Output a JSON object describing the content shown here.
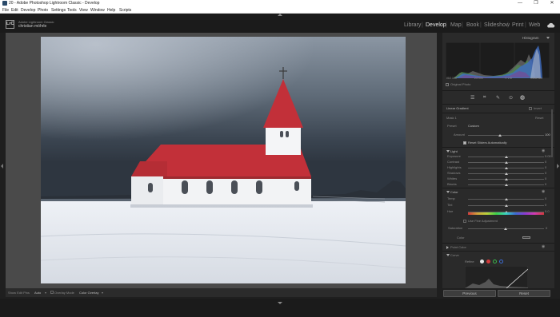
{
  "window": {
    "title": "20 - Adobe Photoshop Lightroom Classic - Develop",
    "controls": [
      "—",
      "❐",
      "✕"
    ]
  },
  "menu": [
    "File",
    "Edit",
    "Develop",
    "Photo",
    "Settings",
    "Tools",
    "View",
    "Window",
    "Help",
    "Scripts"
  ],
  "identity": {
    "logo": "LrC",
    "product": "Adobe Lightroom Classic",
    "user": "christian möhrle"
  },
  "modules": [
    "Library",
    "Develop",
    "Map",
    "Book",
    "Slideshow",
    "Print",
    "Web"
  ],
  "modules_separator": "|",
  "active_module": "Develop",
  "histogram": {
    "title": "Histogram",
    "iso": "ISO 100",
    "focal": "23 mm",
    "aperture": "f / 2.8",
    "shutter": "1/640 sec",
    "original_photo_label": "Original Photo"
  },
  "masking": {
    "mask_name": "Linear Gradient",
    "invert_label": "Invert",
    "mask_label": "Mask 1",
    "reset_label": "Reset",
    "preset_label": "Preset",
    "preset_value": "Custom",
    "amount_label": "Amount",
    "amount_value": "100",
    "reset_sliders_label": "Reset Sliders Automatically"
  },
  "light": {
    "title": "Light",
    "sliders": [
      {
        "label": "Exposure",
        "value": "0.00",
        "pos": 0.5
      },
      {
        "label": "Contrast",
        "value": "0",
        "pos": 0.5
      },
      {
        "label": "Highlights",
        "value": "0",
        "pos": 0.5
      },
      {
        "label": "Shadows",
        "value": "0",
        "pos": 0.5
      },
      {
        "label": "Whites",
        "value": "0",
        "pos": 0.5
      },
      {
        "label": "Blacks",
        "value": "0",
        "pos": 0.5
      }
    ]
  },
  "color": {
    "title": "Color",
    "sliders": [
      {
        "label": "Temp",
        "value": "0",
        "pos": 0.5
      },
      {
        "label": "Tint",
        "value": "0",
        "pos": 0.5
      },
      {
        "label": "Hue",
        "value": "0.0",
        "pos": 0.5
      }
    ],
    "use_fine_adjustment": "Use Fine Adjustment",
    "saturation_label": "Saturation",
    "saturation_value": "0",
    "color_label": "Color"
  },
  "point_color": {
    "title": "Point Color"
  },
  "curve": {
    "title": "Curve",
    "refine_label": "Refine"
  },
  "toolbar": {
    "show_edit_pins_label": "Show Edit Pins",
    "show_edit_pins_value": "Auto",
    "overlay_mode_label": "Overlay Mode",
    "overlay_mode_value": "Color Overlay"
  },
  "buttons": {
    "previous": "Previous",
    "reset": "Reset"
  },
  "colors": {
    "accent": "#e8e8e8",
    "panel": "#2a2a2a",
    "canvas": "#4a4a4a",
    "roof_red": "#c23039"
  }
}
